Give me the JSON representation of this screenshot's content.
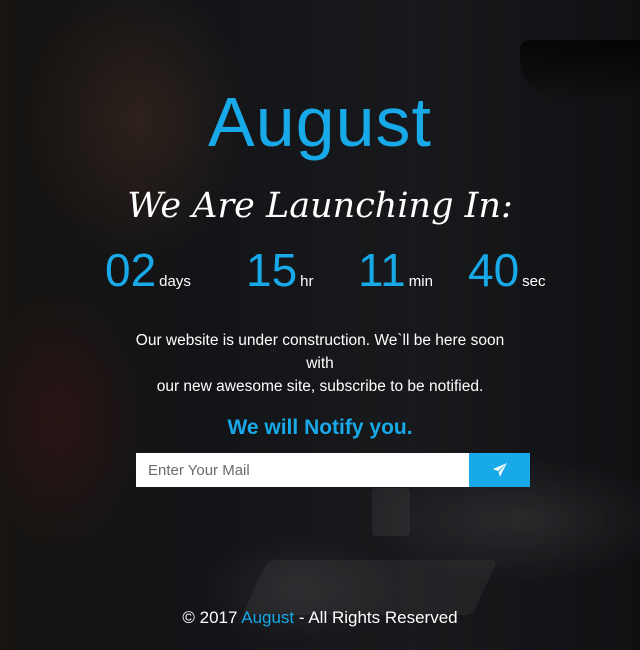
{
  "hero": {
    "brand": "August",
    "tagline": "We Are Launching In:"
  },
  "countdown": [
    {
      "value": "02",
      "unit": "days"
    },
    {
      "value": "15",
      "unit": "hr"
    },
    {
      "value": "11",
      "unit": "min"
    },
    {
      "value": "40",
      "unit": "sec"
    }
  ],
  "description": {
    "line1": "Our website is under construction. We`ll be here soon with",
    "line2": "our new awesome site, subscribe to be notified."
  },
  "subscribe": {
    "title": "We will Notify you.",
    "placeholder": "Enter Your Mail",
    "button_icon": "paper-plane-icon"
  },
  "footer": {
    "prefix": "© 2017 ",
    "brand": "August",
    "suffix": " - All Rights Reserved"
  },
  "colors": {
    "accent": "#18a9e8",
    "text": "#ffffff"
  }
}
